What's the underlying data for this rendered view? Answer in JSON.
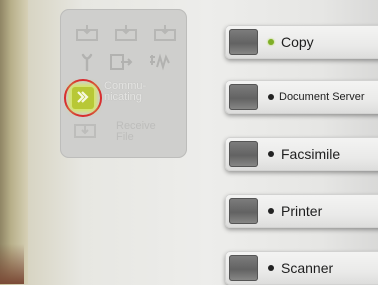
{
  "indicator_panel": {
    "communicating_label": "Commu-\nnicating",
    "receive_file_label": "Receive\nFile"
  },
  "mode_keys": [
    {
      "label": "Copy",
      "indicator": "green",
      "active": true
    },
    {
      "label": "Document Server",
      "indicator": "black",
      "active": false
    },
    {
      "label": "Facsimile",
      "indicator": "black",
      "active": false
    },
    {
      "label": "Printer",
      "indicator": "black",
      "active": false
    },
    {
      "label": "Scanner",
      "indicator": "black",
      "active": false
    }
  ],
  "colors": {
    "panel_bg": "#cfcfcd",
    "highlight_ring": "#d8262e",
    "communicating_light": "#b8c836",
    "copy_indicator": "#7fae27"
  }
}
